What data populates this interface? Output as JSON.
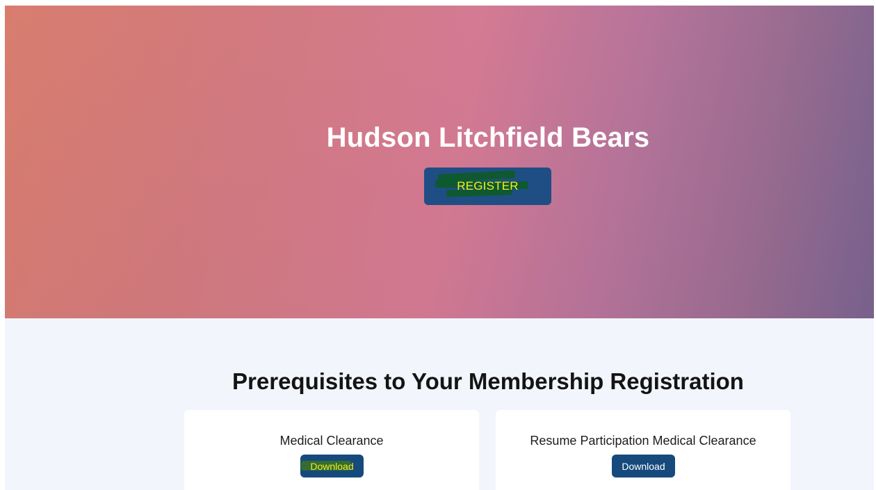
{
  "hero": {
    "title": "Hudson Litchfield Bears",
    "register_label": "REGISTER"
  },
  "prerequisites": {
    "title": "Prerequisites to Your Membership Registration",
    "cards": [
      {
        "title": "Medical Clearance",
        "button_label": "Download"
      },
      {
        "title": "Resume Participation Medical Clearance",
        "button_label": "Download"
      }
    ]
  },
  "colors": {
    "button_navy": "#1f4e85",
    "highlight_yellow": "#f4f01c",
    "section_bg": "#f2f5fc"
  }
}
